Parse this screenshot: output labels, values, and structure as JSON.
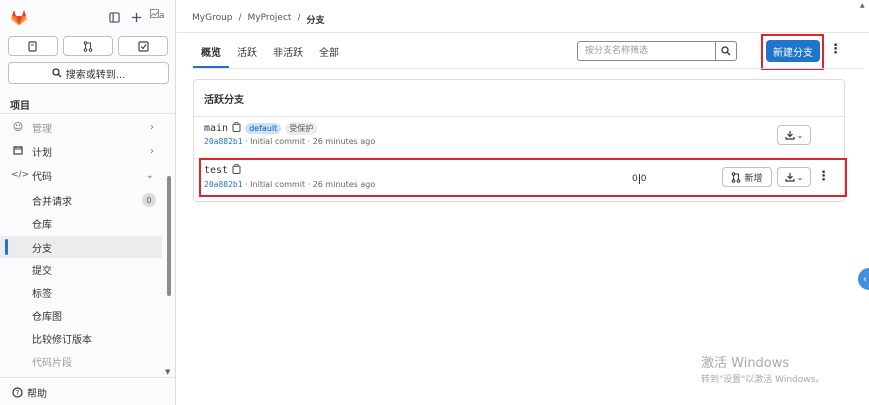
{
  "sidebar": {
    "search_label": "搜索或转到...",
    "section": "项目",
    "items": [
      {
        "label": "管理",
        "icon": "users-icon"
      },
      {
        "label": "计划",
        "icon": "calendar-icon"
      },
      {
        "label": "代码",
        "icon": "code-icon"
      },
      {
        "label": "合并请求",
        "count": "0"
      },
      {
        "label": "仓库"
      },
      {
        "label": "分支"
      },
      {
        "label": "提交"
      },
      {
        "label": "标签"
      },
      {
        "label": "仓库图"
      },
      {
        "label": "比较修订版本"
      },
      {
        "label": "代码片段"
      }
    ],
    "help": "帮助",
    "avatar_alt": "a"
  },
  "breadcrumb": {
    "group": "MyGroup",
    "project": "MyProject",
    "current": "分支",
    "sep": "/"
  },
  "tabs": [
    "概览",
    "活跃",
    "非活跃",
    "全部"
  ],
  "filter": {
    "placeholder": "按分支名称筛选"
  },
  "new_branch_button": "新建分支",
  "card": {
    "title": "活跃分支",
    "branches": [
      {
        "name": "main",
        "badges": [
          "default",
          "受保护"
        ],
        "sha": "20a882b1",
        "message": "· Initial commit · 26 minutes ago"
      },
      {
        "name": "test",
        "sha": "20a882b1",
        "message": "· Initial commit · 26 minutes ago",
        "behind": "0",
        "ahead": "0",
        "new_mr_label": "新增"
      }
    ]
  },
  "watermark": {
    "line1": "激活 Windows",
    "line2": "转到\"设置\"以激活 Windows。"
  },
  "colors": {
    "primary": "#1f75cb",
    "highlight": "#e0232e"
  }
}
